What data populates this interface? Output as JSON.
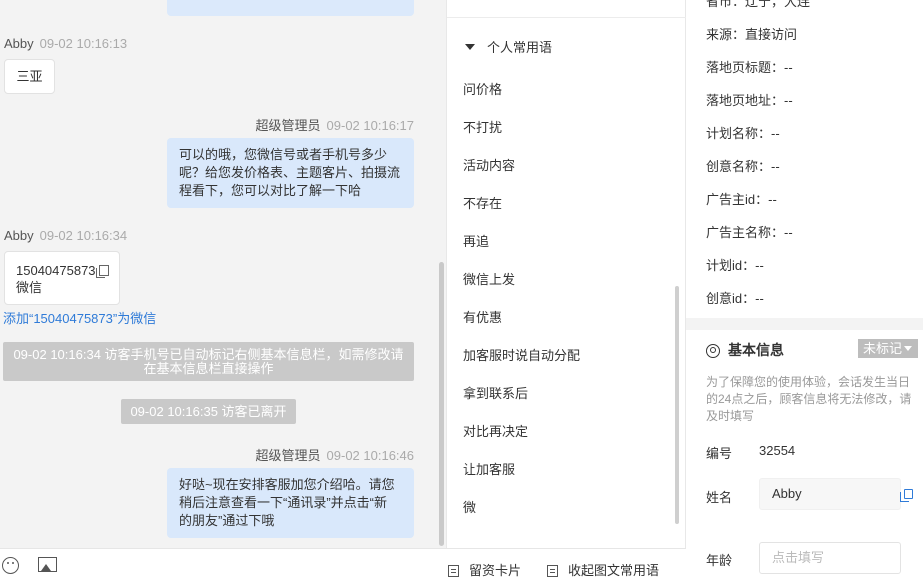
{
  "chat": {
    "messages": [
      {
        "sender": "Abby",
        "time": "09-02 10:16:13",
        "text": "三亚"
      },
      {
        "sender": "超级管理员",
        "time": "09-02 10:16:17",
        "lines": [
          "可以的哦，您微信号或者手机号多少",
          "呢？给您发价格表、主题客片、拍摄流",
          "程看下，您可以对比了解一下哈"
        ]
      },
      {
        "sender": "Abby",
        "time": "09-02 10:16:34",
        "phone": "15040475873",
        "sub": "微信"
      },
      {
        "sender": "超级管理员",
        "time": "09-02 10:16:46",
        "lines": [
          "好哒~现在安排客服加您介绍哈。请您",
          "稍后注意查看一下“通讯录”并点击“新",
          "的朋友”通过下哦"
        ]
      }
    ],
    "add_wechat_link": "添加“15040475873”为微信",
    "system_notes": [
      {
        "lines": [
          "09-02 10:16:34 访客手机号已自动标记右侧基本信息栏，如需修改请",
          "在基本信息栏直接操作"
        ]
      },
      {
        "lines": [
          "09-02 10:16:35 访客已离开"
        ]
      }
    ],
    "toolbar": {
      "emoji_icon": "smile-icon",
      "image_icon": "image-icon",
      "leave_card": "留资卡片",
      "collapse_phrases": "收起图文常用语"
    }
  },
  "phrases": {
    "header": "个人常用语",
    "items": [
      "问价格",
      "不打扰",
      "活动内容",
      "不存在",
      "再追",
      "微信上发",
      "有优惠",
      "加客服时说自动分配",
      "拿到联系后",
      "对比再决定",
      "让加客服",
      "微"
    ]
  },
  "info": {
    "top_partial": "省市：辽宁，大连",
    "rows": [
      {
        "label": "来源：",
        "value": "直接访问"
      },
      {
        "label": "落地页标题：",
        "value": "--"
      },
      {
        "label": "落地页地址：",
        "value": "--"
      },
      {
        "label": "计划名称：",
        "value": "--"
      },
      {
        "label": "创意名称：",
        "value": "--"
      },
      {
        "label": "广告主id：",
        "value": "--"
      },
      {
        "label": "广告主名称：",
        "value": "--"
      },
      {
        "label": "计划id：",
        "value": "--"
      },
      {
        "label": "创意id：",
        "value": "--"
      }
    ],
    "basic": {
      "title": "基本信息",
      "tag": "未标记",
      "tip": "为了保障您的使用体验，会话发生当日的24点之后，顾客信息将无法修改，请及时填写",
      "id_label": "编号",
      "id_value": "32554",
      "name_label": "姓名",
      "name_value": "Abby",
      "age_label": "年龄",
      "age_placeholder": "点击填写"
    }
  }
}
